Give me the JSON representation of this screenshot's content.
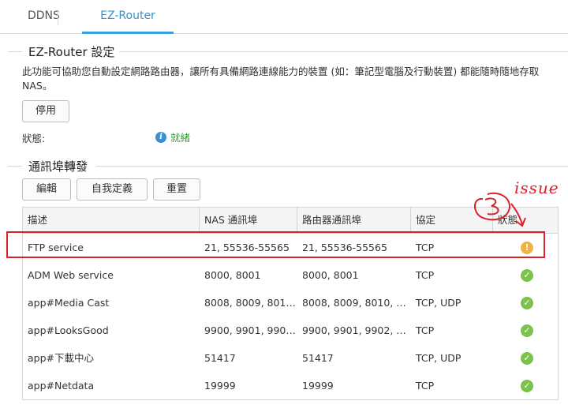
{
  "tabs": [
    {
      "label": "DDNS"
    },
    {
      "label": "EZ-Router"
    }
  ],
  "ez_router": {
    "title": "EZ-Router 設定",
    "description": "此功能可協助您自動設定網路路由器，讓所有具備網路連線能力的裝置 (如：筆記型電腦及行動裝置) 都能隨時隨地存取 NAS。",
    "disable_button": "停用",
    "status_label": "狀態:",
    "status_value": "就緒"
  },
  "port_forwarding": {
    "title": "通訊埠轉發",
    "buttons": {
      "edit": "編輯",
      "custom": "自我定義",
      "reset": "重置"
    },
    "columns": [
      "描述",
      "NAS 通訊埠",
      "路由器通訊埠",
      "協定",
      "狀態"
    ],
    "rows": [
      {
        "desc": "FTP service",
        "nas": "21, 55536-55565",
        "router": "21, 55536-55565",
        "protocol": "TCP",
        "status": "warning",
        "status_color": "#f0b243"
      },
      {
        "desc": "ADM Web service",
        "nas": "8000, 8001",
        "router": "8000, 8001",
        "protocol": "TCP",
        "status": "ok",
        "status_color": "#7cc24c"
      },
      {
        "desc": "app#Media Cast",
        "nas": "8008, 8009, 8010, ...",
        "router": "8008, 8009, 8010, 801...",
        "protocol": "TCP, UDP",
        "status": "ok",
        "status_color": "#7cc24c"
      },
      {
        "desc": "app#LooksGood",
        "nas": "9900, 9901, 9902, ...",
        "router": "9900, 9901, 9902, 990...",
        "protocol": "TCP",
        "status": "ok",
        "status_color": "#7cc24c"
      },
      {
        "desc": "app#下載中心",
        "nas": "51417",
        "router": "51417",
        "protocol": "TCP, UDP",
        "status": "ok",
        "status_color": "#7cc24c"
      },
      {
        "desc": "app#Netdata",
        "nas": "19999",
        "router": "19999",
        "protocol": "TCP",
        "status": "ok",
        "status_color": "#7cc24c"
      }
    ]
  },
  "annotation": {
    "text": "issue",
    "color": "#d8222a"
  },
  "colors": {
    "accent": "#3aa0d8",
    "ready": "#3c9b3c",
    "ok": "#7cc24c",
    "warning": "#f0b243"
  }
}
